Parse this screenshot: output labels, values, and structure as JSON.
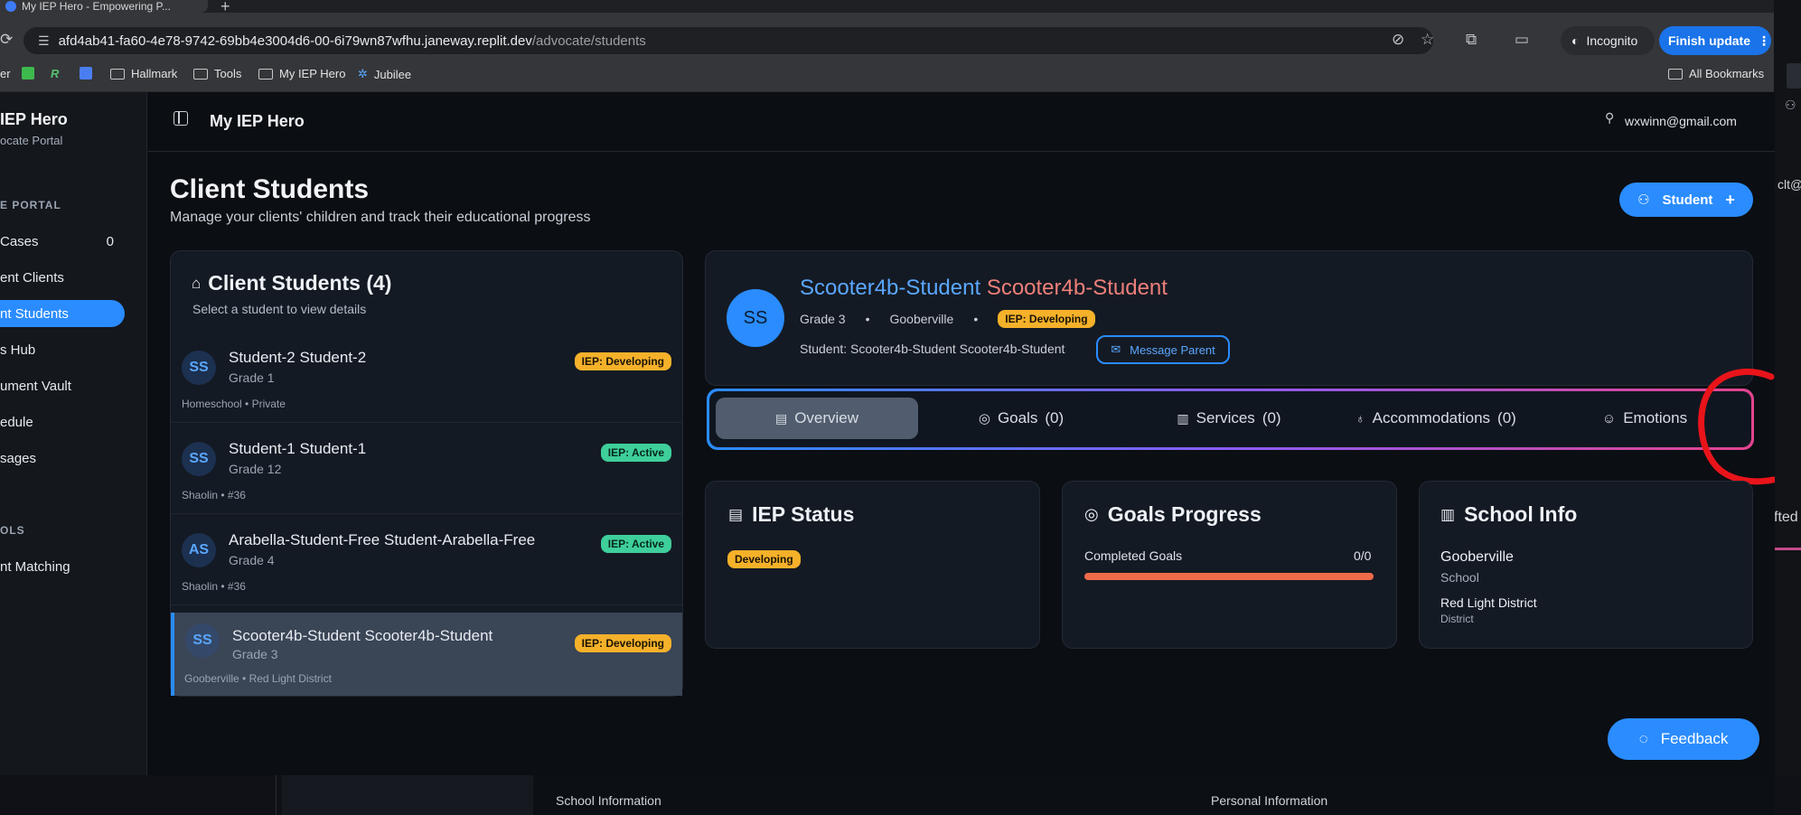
{
  "browser": {
    "tab_title": "My IEP Hero - Empowering P...",
    "new_tab": "+",
    "url_host": "afd4ab41-fa60-4e78-9742-69bb4e3004d6-00-6i79wn87wfhu.janeway.replit.dev",
    "url_path": "/advocate/students",
    "incognito_label": "Incognito",
    "finish_update_label": "Finish update",
    "bookmarks": [
      "Hallmark",
      "Tools",
      "My IEP Hero",
      "Jubilee"
    ],
    "bookmark_fragment": "er",
    "all_bookmarks": "All Bookmarks"
  },
  "sidebar": {
    "brand": "IEP Hero",
    "subtitle": "ocate Portal",
    "section_portal": "E PORTAL",
    "items": [
      {
        "label": "Cases",
        "count": "0"
      },
      {
        "label": "ent Clients"
      },
      {
        "label": "nt Students"
      },
      {
        "label": "s Hub"
      },
      {
        "label": "ument Vault"
      },
      {
        "label": "edule"
      },
      {
        "label": "sages"
      }
    ],
    "section_tools": "OLS",
    "tools_items": [
      {
        "label": "nt Matching"
      }
    ]
  },
  "header": {
    "app_title": "My IEP Hero",
    "user_email": "wxwinn@gmail.com"
  },
  "page": {
    "title": "Client Students",
    "subtitle": "Manage your clients' children and track their educational progress",
    "add_student_label": "Student"
  },
  "list": {
    "title": "Client Students (4)",
    "subtitle": "Select a student to view details",
    "students": [
      {
        "initials": "SS",
        "name": "Student-2 Student-2",
        "grade": "Grade 1",
        "meta": "Homeschool • Private",
        "status": "IEP: Developing",
        "status_type": "developing"
      },
      {
        "initials": "SS",
        "name": "Student-1 Student-1",
        "grade": "Grade 12",
        "meta": "Shaolin • #36",
        "status": "IEP: Active",
        "status_type": "active"
      },
      {
        "initials": "AS",
        "name": "Arabella-Student-Free Student-Arabella-Free",
        "grade": "Grade 4",
        "meta": "Shaolin • #36",
        "status": "IEP: Active",
        "status_type": "active"
      },
      {
        "initials": "SS",
        "name": "Scooter4b-Student Scooter4b-Student",
        "grade": "Grade 3",
        "meta": "Gooberville • Red Light District",
        "status": "IEP: Developing",
        "status_type": "developing"
      }
    ]
  },
  "detail": {
    "initials": "SS",
    "name_first": "Scooter4b-Student",
    "name_last": "Scooter4b-Student",
    "grade": "Grade 3",
    "school": "Gooberville",
    "status": "IEP: Developing",
    "student_line": "Student: Scooter4b-Student Scooter4b-Student",
    "message_parent": "Message Parent",
    "tabs": [
      {
        "label": "Overview"
      },
      {
        "label": "Goals",
        "count": "(0)"
      },
      {
        "label": "Services",
        "count": "(0)"
      },
      {
        "label": "Accommodations",
        "count": "(0)"
      },
      {
        "label": "Emotions"
      }
    ],
    "iep_status": {
      "title": "IEP Status",
      "badge": "Developing"
    },
    "goals_progress": {
      "title": "Goals Progress",
      "label": "Completed Goals",
      "value": "0/0",
      "progress": 0
    },
    "school_info": {
      "title": "School Info",
      "school": "Gooberville",
      "school_label": "School",
      "district": "Red Light District",
      "district_label": "District"
    }
  },
  "feedback_label": "Feedback",
  "background_app": {
    "school_information": "School Information",
    "personal_information": "Personal Information",
    "fragment_right_1": "clt@",
    "fragment_right_2": "fted"
  },
  "colors": {
    "accent": "#2a8cff",
    "developing": "#f5b12a",
    "active": "#3ecf9b",
    "progress": "#ef6b4a",
    "annotation": "#e8141a"
  }
}
